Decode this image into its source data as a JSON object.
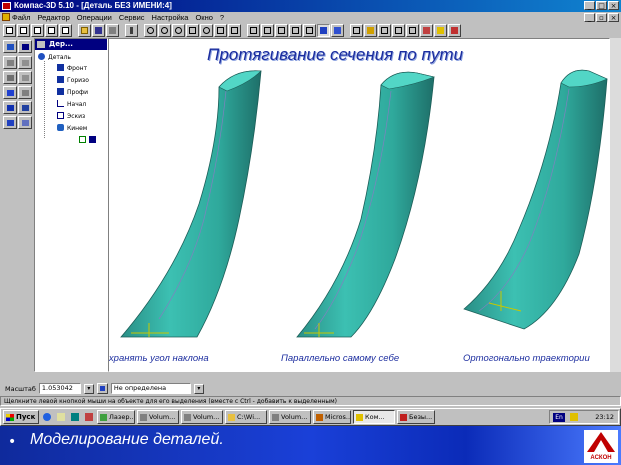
{
  "window": {
    "title": "Компас-3D 5.10 - [Деталь БЕЗ ИМЕНИ:4]"
  },
  "menu": [
    "Файл",
    "Редактор",
    "Операции",
    "Сервис",
    "Настройка",
    "Окно",
    "?"
  ],
  "tree": {
    "title": "Дер...",
    "items": [
      "Деталь",
      "Фронт",
      "Горизо",
      "Профи",
      "Начал",
      "Эскиз",
      "Кинем"
    ]
  },
  "canvas": {
    "title": "Протягивание сечения по пути",
    "captions": [
      "Сохранять угол наклона",
      "Параллельно самому себе",
      "Ортогонально траектории"
    ]
  },
  "status": {
    "scale_label": "Масштаб",
    "scale_value": "1.053042",
    "state_value": "Не определена",
    "hint": "Щелкните левой кнопкой мыши на объекте для его выделения (вместе с Ctrl - добавить к выделенным)"
  },
  "taskbar": {
    "start_label": "Пуск",
    "tasks": [
      "Лазер...",
      "Volum...",
      "Volum...",
      "C:\\Wi...",
      "Volum...",
      "Micros...",
      "Ком...",
      "Безы..."
    ],
    "lang": "En",
    "time": "23:12"
  },
  "slide": {
    "bullet": "•",
    "text": "Моделирование деталей."
  },
  "logo_text": "АСКОН",
  "colors": {
    "solid_fill": "#36b0a4",
    "caption_blue": "#1e2fa0",
    "slide_blue": "#1a40d8"
  }
}
